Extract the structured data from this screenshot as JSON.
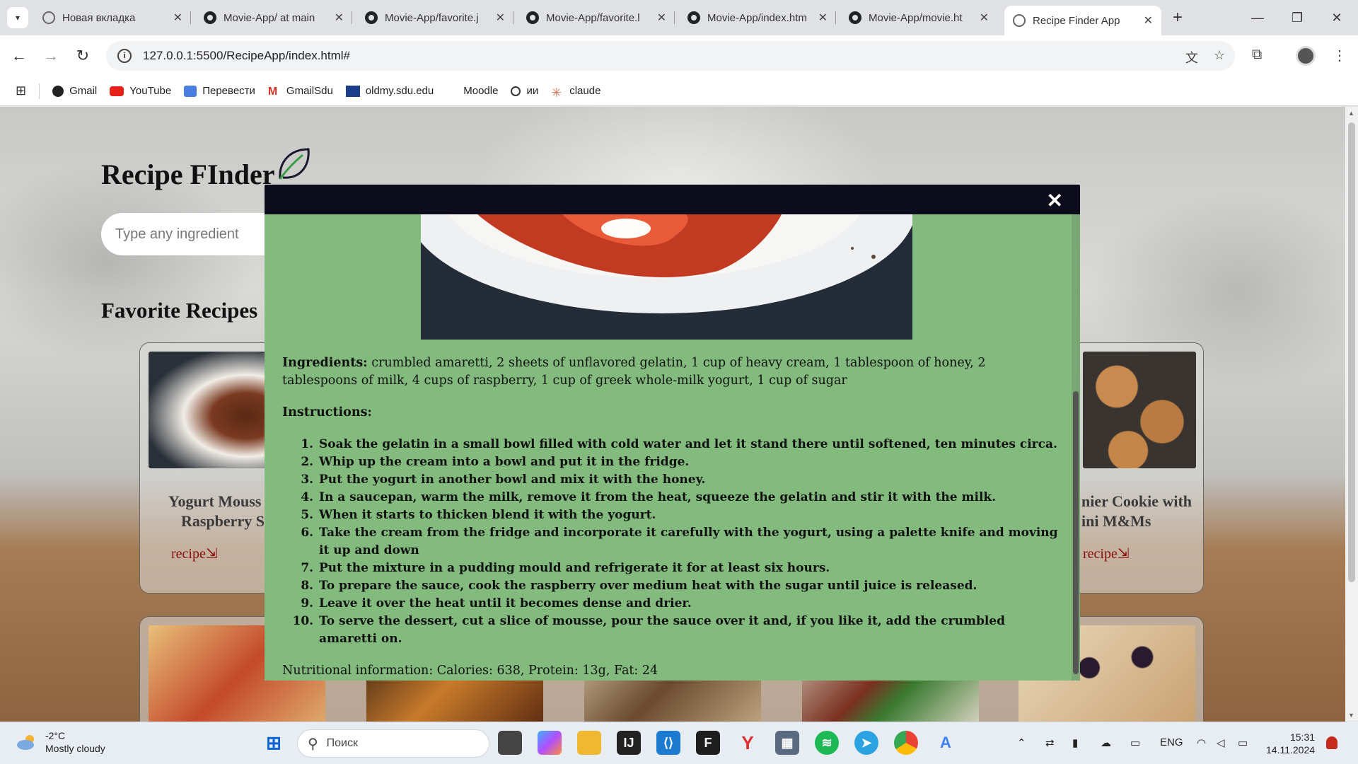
{
  "browser": {
    "tabs": [
      {
        "title": "Новая вкладка",
        "icon": "chrome-icon"
      },
      {
        "title": "Movie-App/ at main",
        "icon": "github-icon"
      },
      {
        "title": "Movie-App/favorite.j",
        "icon": "github-icon"
      },
      {
        "title": "Movie-App/favorite.l",
        "icon": "github-icon"
      },
      {
        "title": "Movie-App/index.htm",
        "icon": "github-icon"
      },
      {
        "title": "Movie-App/movie.ht",
        "icon": "github-icon"
      },
      {
        "title": "Recipe Finder App",
        "icon": "globe-icon",
        "active": true
      }
    ],
    "url": "127.0.0.1:5500/RecipeApp/index.html#",
    "bookmarks": [
      {
        "label": "Gmail",
        "icon": "gmail-icon"
      },
      {
        "label": "YouTube",
        "icon": "youtube-icon"
      },
      {
        "label": "Перевести",
        "icon": "translate-icon"
      },
      {
        "label": "GmailSdu",
        "icon": "gmail-icon"
      },
      {
        "label": "oldmy.sdu.edu",
        "icon": "sdu-icon"
      },
      {
        "label": "Moodle",
        "icon": "moodle-icon"
      },
      {
        "label": "ии",
        "icon": "openai-icon"
      },
      {
        "label": "claude",
        "icon": "claude-icon"
      }
    ]
  },
  "page": {
    "title": "Recipe FInder",
    "search_placeholder": "Type any ingredient",
    "favorites_title": "Favorite Recipes",
    "cards": [
      {
        "name_line1": "Yogurt Mouss",
        "name_line2": "Raspberry S",
        "link": "recipe⇲"
      },
      {
        "name_line1": "nier Cookie with",
        "name_line2": "ini M&Ms",
        "link": "recipe⇲"
      }
    ]
  },
  "modal": {
    "close_label": "✕",
    "ingredients_label": "Ingredients:",
    "ingredients": "crumbled amaretti, 2 sheets of unflavored gelatin, 1 cup of heavy cream, 1 tablespoon of honey, 2 tablespoons of milk, 4 cups of raspberry, 1 cup of greek whole-milk yogurt, 1 cup of sugar",
    "instructions_label": "Instructions:",
    "instructions": [
      "Soak the gelatin in a small bowl filled with cold water and let it stand there until softened, ten minutes circa.",
      "Whip up the cream into a bowl and put it in the fridge.",
      "Put the yogurt in another bowl and mix it with the honey.",
      "In a saucepan, warm the milk, remove it from the heat, squeeze the gelatin and stir it with the milk.",
      "When it starts to thicken blend it with the yogurt.",
      "Take the cream from the fridge and incorporate it carefully with the yogurt, using a palette knife and moving it up and down",
      "Put the mixture in a pudding mould and refrigerate it for at least six hours.",
      "To prepare the sauce, cook the raspberry over medium heat with the sugar until juice is released.",
      "Leave it over the heat until it becomes dense and drier.",
      "To serve the dessert, cut a slice of mousse, pour the sauce over it and, if you like it, add the crumbled amaretti on."
    ],
    "nutrition": "Nutritional information: Calories: 638, Protein: 13g, Fat: 24"
  },
  "taskbar": {
    "weather_temp": "-2°C",
    "weather_desc": "Mostly cloudy",
    "search_placeholder": "Поиск",
    "language": "ENG",
    "time": "15:31",
    "date": "14.11.2024"
  }
}
